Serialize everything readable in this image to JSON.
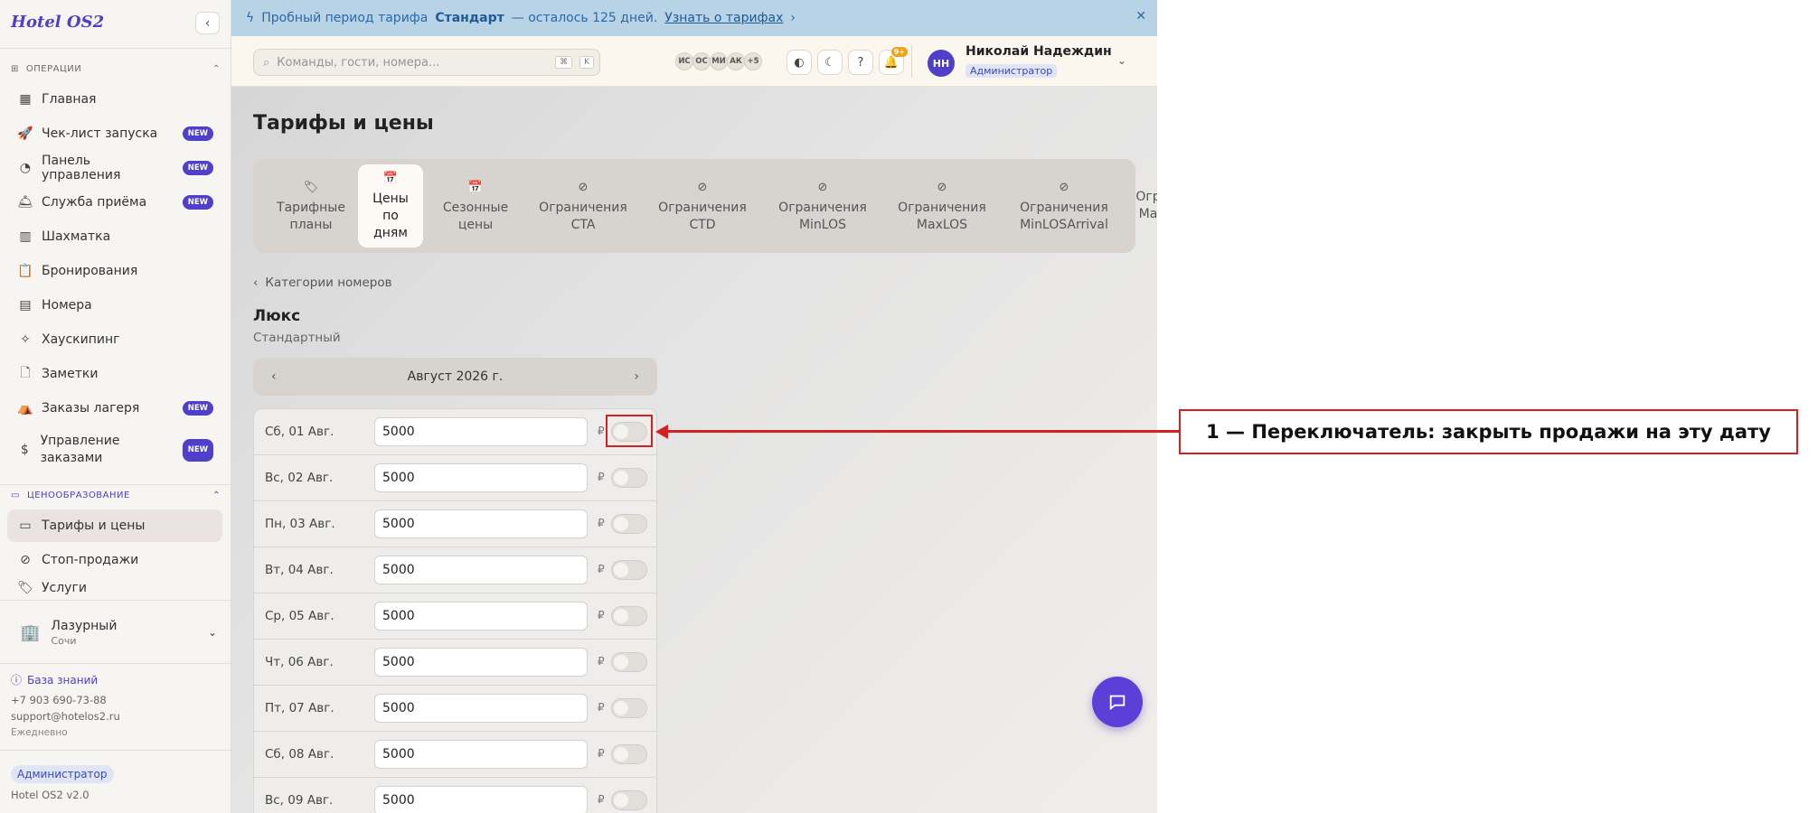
{
  "app": {
    "logo": "Hotel OS2",
    "collapse_icon": "‹"
  },
  "sidebar": {
    "section_operations": "Операции",
    "section_pricing": "Ценообразование",
    "new_badge": "NEW",
    "items": [
      {
        "label": "Главная",
        "icon": "▦",
        "new": false
      },
      {
        "label": "Чек-лист запуска",
        "icon": "🚀",
        "new": true
      },
      {
        "label": "Панель управления",
        "icon": "◔",
        "new": true
      },
      {
        "label": "Служба приёма",
        "icon": "🛎",
        "new": true
      },
      {
        "label": "Шахматка",
        "icon": "▥",
        "new": false
      },
      {
        "label": "Бронирования",
        "icon": "📋",
        "new": false
      },
      {
        "label": "Номера",
        "icon": "▤",
        "new": false
      },
      {
        "label": "Хаускипинг",
        "icon": "✧",
        "new": false
      },
      {
        "label": "Заметки",
        "icon": "🗋",
        "new": false
      },
      {
        "label": "Заказы лагеря",
        "icon": "⛺",
        "new": true
      },
      {
        "label": "Управление заказами",
        "icon": "$",
        "new": true
      }
    ],
    "pricing_items": [
      {
        "label": "Тарифы и цены",
        "icon": "▭"
      },
      {
        "label": "Стоп-продажи",
        "icon": "⊘"
      },
      {
        "label": "Услуги",
        "icon": "🏷"
      }
    ],
    "hotel": {
      "name": "Лазурный",
      "city": "Сочи"
    },
    "knowledge_base": "База знаний",
    "phone": "+7 903 690-73-88",
    "email": "support@hotelos2.ru",
    "schedule": "Ежедневно",
    "role": "Администратор",
    "version": "Hotel OS2 v2.0"
  },
  "banner": {
    "prefix": "Пробный период тарифа",
    "plan": "Стандарт",
    "suffix": "— осталось 125 дней.",
    "link": "Узнать о тарифах"
  },
  "topbar": {
    "search_placeholder": "Команды, гости, номера...",
    "kbd1": "⌘",
    "kbd2": "K",
    "avatars": [
      "ИС",
      "ОС",
      "МИ",
      "АК",
      "+5"
    ],
    "notif_count": "9+",
    "user_initials": "НН",
    "user_name": "Николай Надеждин",
    "user_role": "Администратор"
  },
  "main": {
    "title": "Тарифы и цены",
    "tabs": [
      {
        "label": "Тарифные\nпланы",
        "icon": "🏷"
      },
      {
        "label": "Цены\nпо\nдням",
        "icon": "📅"
      },
      {
        "label": "Сезонные\nцены",
        "icon": "📅"
      },
      {
        "label": "Ограничения\nCTA",
        "icon": "⊘"
      },
      {
        "label": "Ограничения\nCTD",
        "icon": "⊘"
      },
      {
        "label": "Ограничения\nMinLOS",
        "icon": "⊘"
      },
      {
        "label": "Ограничения\nMaxLOS",
        "icon": "⊘"
      },
      {
        "label": "Ограничения\nMinLOSArrival",
        "icon": "⊘"
      },
      {
        "label": "Огр\nMa",
        "icon": ""
      }
    ],
    "back_link": "Категории номеров",
    "room_title": "Люкс",
    "room_subtitle": "Стандартный",
    "month": "Август 2026 г.",
    "currency": "₽",
    "rows": [
      {
        "date": "Сб, 01 Авг.",
        "price": "5000",
        "closed": false
      },
      {
        "date": "Вс, 02 Авг.",
        "price": "5000",
        "closed": false
      },
      {
        "date": "Пн, 03 Авг.",
        "price": "5000",
        "closed": false
      },
      {
        "date": "Вт, 04 Авг.",
        "price": "5000",
        "closed": false
      },
      {
        "date": "Ср, 05 Авг.",
        "price": "5000",
        "closed": false
      },
      {
        "date": "Чт, 06 Авг.",
        "price": "5000",
        "closed": false
      },
      {
        "date": "Пт, 07 Авг.",
        "price": "5000",
        "closed": false
      },
      {
        "date": "Сб, 08 Авг.",
        "price": "5000",
        "closed": false
      },
      {
        "date": "Вс, 09 Авг.",
        "price": "5000",
        "closed": false
      }
    ]
  },
  "annotation": {
    "label": "1 — Переключатель: закрыть продажи на эту дату",
    "color": "#d32020"
  }
}
